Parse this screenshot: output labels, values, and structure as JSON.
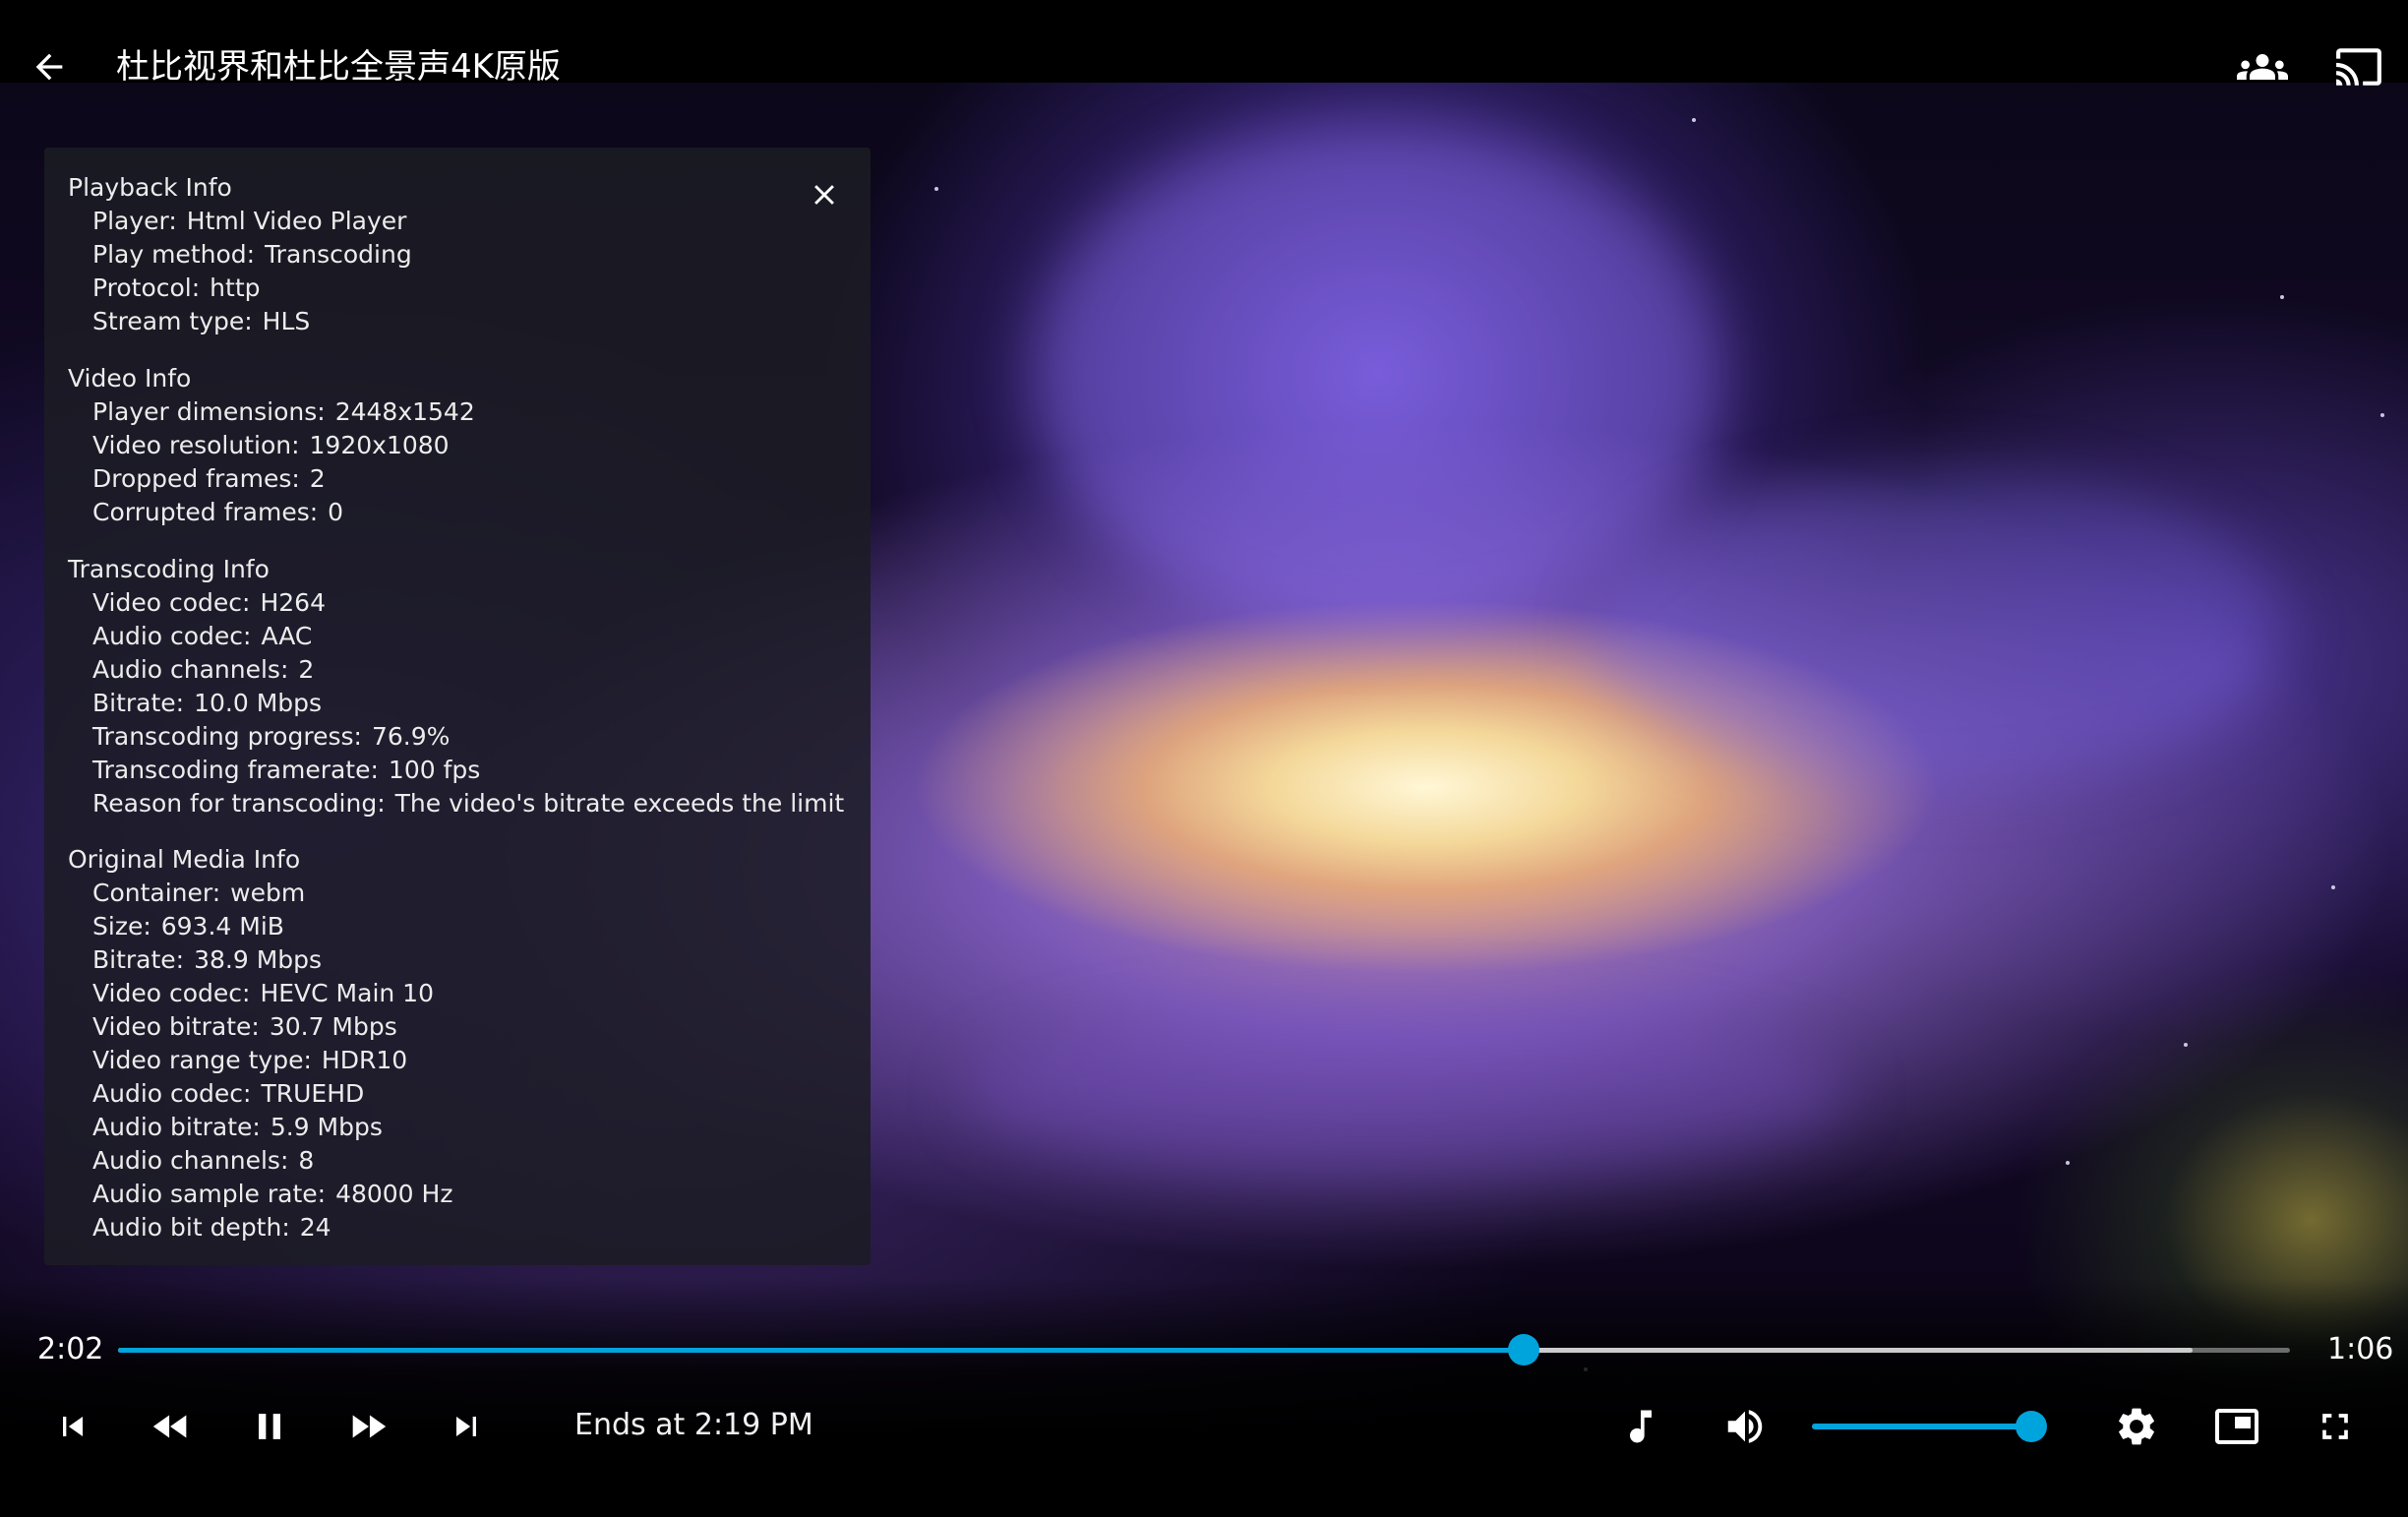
{
  "header": {
    "title": "杜比视界和杜比全景声4K原版",
    "back_icon": "arrow-left-icon",
    "sync_icon": "group-sync-icon",
    "cast_icon": "cast-icon"
  },
  "info_panel": {
    "close_icon": "close-icon",
    "sections": [
      {
        "title": "Playback Info",
        "rows": [
          {
            "label": "Player:",
            "value": "Html Video Player"
          },
          {
            "label": "Play method:",
            "value": "Transcoding"
          },
          {
            "label": "Protocol:",
            "value": "http"
          },
          {
            "label": "Stream type:",
            "value": "HLS"
          }
        ]
      },
      {
        "title": "Video Info",
        "rows": [
          {
            "label": "Player dimensions:",
            "value": "2448x1542"
          },
          {
            "label": "Video resolution:",
            "value": "1920x1080"
          },
          {
            "label": "Dropped frames:",
            "value": "2"
          },
          {
            "label": "Corrupted frames:",
            "value": "0"
          }
        ]
      },
      {
        "title": "Transcoding Info",
        "rows": [
          {
            "label": "Video codec:",
            "value": "H264"
          },
          {
            "label": "Audio codec:",
            "value": "AAC"
          },
          {
            "label": "Audio channels:",
            "value": "2"
          },
          {
            "label": "Bitrate:",
            "value": "10.0 Mbps"
          },
          {
            "label": "Transcoding progress:",
            "value": "76.9%"
          },
          {
            "label": "Transcoding framerate:",
            "value": "100 fps"
          },
          {
            "label": "Reason for transcoding:",
            "value": "The video's bitrate exceeds the limit"
          }
        ]
      },
      {
        "title": "Original Media Info",
        "rows": [
          {
            "label": "Container:",
            "value": "webm"
          },
          {
            "label": "Size:",
            "value": "693.4 MiB"
          },
          {
            "label": "Bitrate:",
            "value": "38.9 Mbps"
          },
          {
            "label": "Video codec:",
            "value": "HEVC Main 10"
          },
          {
            "label": "Video bitrate:",
            "value": "30.7 Mbps"
          },
          {
            "label": "Video range type:",
            "value": "HDR10"
          },
          {
            "label": "Audio codec:",
            "value": "TRUEHD"
          },
          {
            "label": "Audio bitrate:",
            "value": "5.9 Mbps"
          },
          {
            "label": "Audio channels:",
            "value": "8"
          },
          {
            "label": "Audio sample rate:",
            "value": "48000 Hz"
          },
          {
            "label": "Audio bit depth:",
            "value": "24"
          }
        ]
      }
    ]
  },
  "playback": {
    "current_time": "2:02",
    "remaining_time": "1:06",
    "progress_fraction": 0.647,
    "buffered_fraction": 0.955,
    "ends_at": "Ends at 2:19 PM",
    "volume_fraction": 0.95,
    "accent_color": "#00a4dc"
  },
  "controls": {
    "previous_icon": "skip-previous-icon",
    "rewind_icon": "rewind-icon",
    "pause_icon": "pause-icon",
    "fast_forward_icon": "fast-forward-icon",
    "next_icon": "skip-next-icon",
    "audio_track_icon": "music-note-icon",
    "volume_icon": "volume-up-icon",
    "settings_icon": "gear-icon",
    "pip_icon": "picture-in-picture-icon",
    "fullscreen_icon": "fullscreen-icon"
  }
}
